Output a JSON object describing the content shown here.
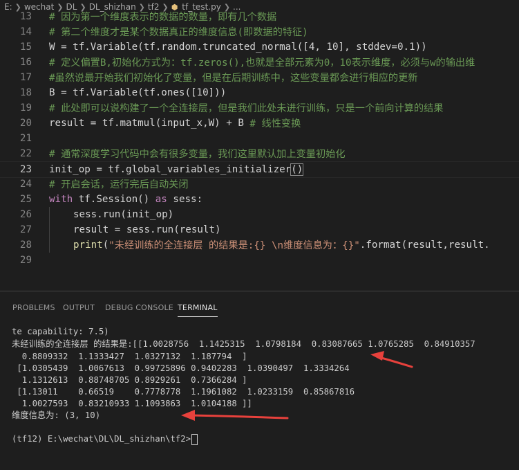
{
  "breadcrumb": {
    "items": [
      "E:",
      "wechat",
      "DL",
      "DL_shizhan",
      "tf2",
      "tf_test.py",
      "..."
    ],
    "file_icon": "python-file-icon"
  },
  "editor": {
    "lines": [
      {
        "num": "13",
        "text": "# 因为第一个维度表示的数据的数量，即有几个数据"
      },
      {
        "num": "14",
        "text": "# 第二个维度才是某个数据真正的维度信息(即数据的特征)"
      },
      {
        "num": "15",
        "text": "W = tf.Variable(tf.random.truncated_normal([4, 10], stddev=0.1))"
      },
      {
        "num": "16",
        "text": "# 定义偏置B,初始化方式为：tf.zeros(),也就是全部元素为0，10表示维度，必须与w的输出维"
      },
      {
        "num": "17",
        "text": "#虽然说最开始我们初始化了变量，但是在后期训练中，这些变量都会进行相应的更新"
      },
      {
        "num": "18",
        "text": "B = tf.Variable(tf.ones([10]))"
      },
      {
        "num": "19",
        "text": "# 此处即可以说构建了一个全连接层，但是我们此处未进行训练，只是一个前向计算的结果"
      },
      {
        "num": "20",
        "code": "result = tf.matmul(input_x,W) + B ",
        "comment": "# 线性变换"
      },
      {
        "num": "21",
        "text": ""
      },
      {
        "num": "22",
        "text": "# 通常深度学习代码中会有很多变量，我们这里默认加上变量初始化"
      },
      {
        "num": "23",
        "code": "init_op = tf.global_variables_initializer",
        "tail": "()"
      },
      {
        "num": "24",
        "text": "# 开启会话，运行完后自动关闭"
      },
      {
        "num": "25",
        "kw1": "with",
        "mid": " tf.Session() ",
        "kw2": "as",
        "end": " sess:"
      },
      {
        "num": "26",
        "text": "sess.run(init_op)"
      },
      {
        "num": "27",
        "text": "result = sess.run(result)"
      },
      {
        "num": "28",
        "fn": "print",
        "open": "(",
        "str": "\"未经训练的全连接层 的结果是:{} \\n维度信息为：{}\"",
        "rest": ".format(result,result."
      },
      {
        "num": "29",
        "text": ""
      }
    ]
  },
  "panel": {
    "tabs": [
      "PROBLEMS",
      "OUTPUT",
      "DEBUG CONSOLE",
      "TERMINAL"
    ],
    "active_tab": "TERMINAL"
  },
  "terminal": {
    "lines": [
      "te capability: 7.5)",
      "未经训练的全连接层 的结果是:[[1.0028756  1.1425315  1.0798184  0.83087665 1.0765285  0.84910357",
      "  0.8809332  1.1333427  1.0327132  1.187794  ]",
      " [1.0305439  1.0067613  0.99725896 0.9402283  1.0390497  1.3334264",
      "  1.1312613  0.88748705 0.8929261  0.7366284 ]",
      " [1.13011    0.66519    0.7778778  1.1961082  1.0233159  0.85867816",
      "  1.0027593  0.83210933 1.1093863  1.0104188 ]]",
      "维度信息为: (3, 10)",
      "",
      "(tf12) E:\\wechat\\DL\\DL_shizhan\\tf2>"
    ]
  },
  "colors": {
    "background": "#1e1e1e",
    "comment": "#6a9955",
    "keyword": "#c586c0",
    "string": "#ce9178",
    "function": "#dcdcaa",
    "annotation_arrow": "#e8413c"
  }
}
